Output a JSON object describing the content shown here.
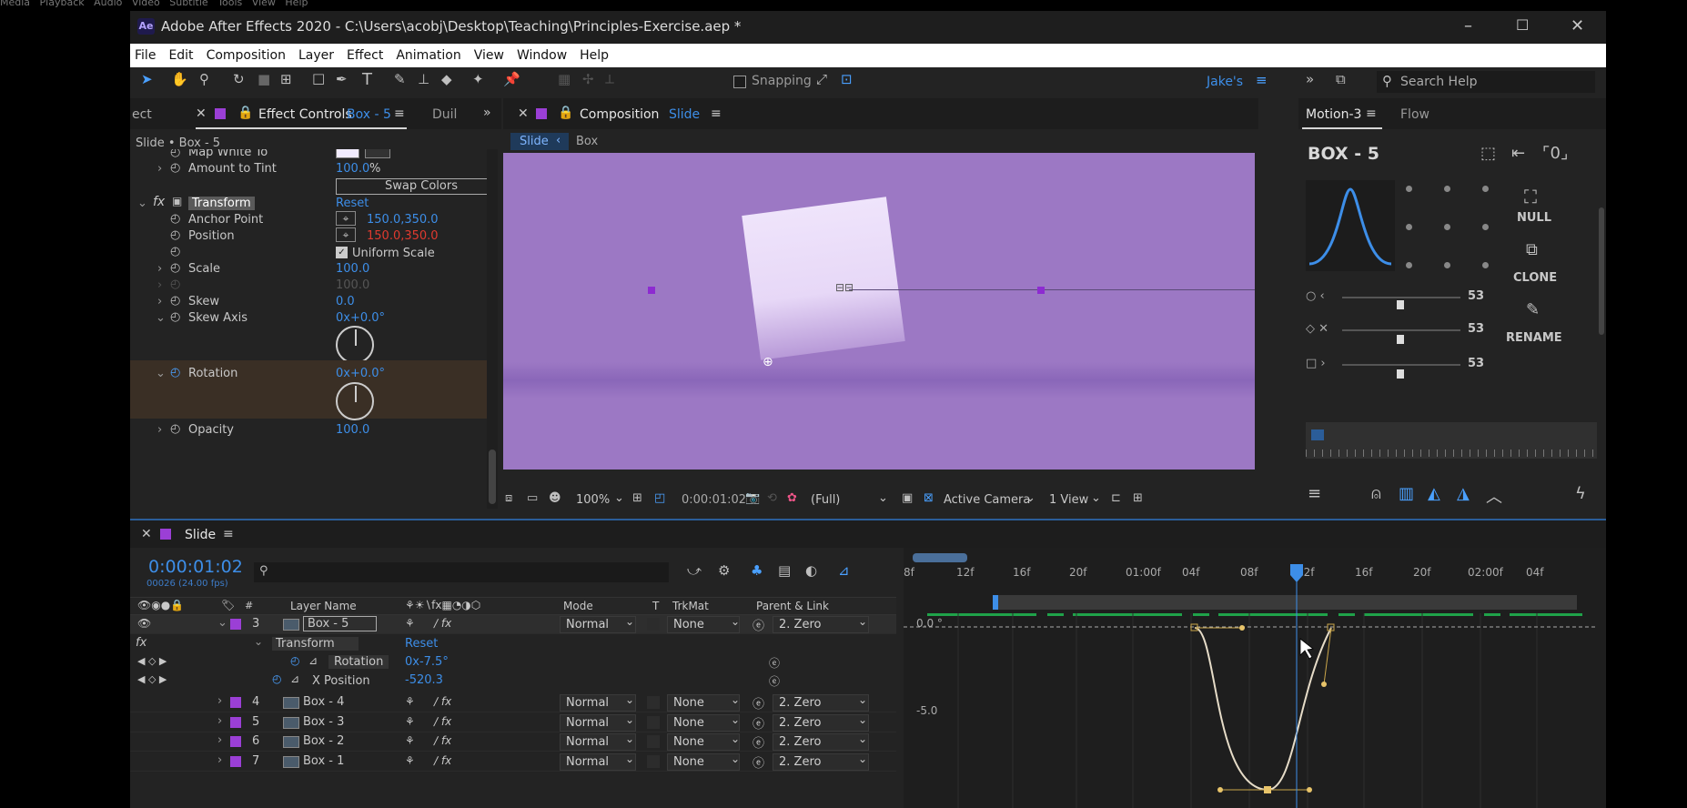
{
  "top_menu_bg": [
    "Media",
    "Playback",
    "Audio",
    "Video",
    "Subtitle",
    "Tools",
    "View",
    "Help"
  ],
  "window": {
    "app_icon": "Ae",
    "title": "Adobe After Effects 2020 - C:\\Users\\acobj\\Desktop\\Teaching\\Principles-Exercise.aep *",
    "controls": {
      "min": "–",
      "max": "☐",
      "close": "✕"
    }
  },
  "menu": [
    "File",
    "Edit",
    "Composition",
    "Layer",
    "Effect",
    "Animation",
    "View",
    "Window",
    "Help"
  ],
  "toolbar": {
    "snapping": "Snapping",
    "workspace": "Jake's",
    "search_placeholder": "Search Help"
  },
  "effect_panel": {
    "tab_prev": "ect",
    "tab_label": "Effect Controls",
    "tab_layer": "Box - 5",
    "tab_next": "Duil",
    "breadcrumb": "Slide • Box - 5",
    "props": {
      "map_white": "Map White To",
      "amount_tint": "Amount to Tint",
      "amount_tint_val": "100.0",
      "amount_tint_unit": "%",
      "swap_colors": "Swap Colors",
      "fx": "fx",
      "transform": "Transform",
      "reset": "Reset",
      "anchor": "Anchor Point",
      "anchor_val": "150.0,350.0",
      "position": "Position",
      "position_val": "150.0,350.0",
      "uniform_scale": "Uniform Scale",
      "scale": "Scale",
      "scale_val": "100.0",
      "scale_h_val": "100.0",
      "skew": "Skew",
      "skew_val": "0.0",
      "skew_axis": "Skew Axis",
      "skew_axis_val": "0x+0.0°",
      "rotation": "Rotation",
      "rotation_val": "0x+0.0°",
      "opacity": "Opacity",
      "opacity_val": "100.0"
    }
  },
  "comp_panel": {
    "tab_label": "Composition",
    "tab_name": "Slide",
    "crumb1": "Slide",
    "crumb2": "Box",
    "zoom": "100%",
    "timecode": "0:00:01:02",
    "resolution": "(Full)",
    "camera": "Active Camera",
    "views": "1 View"
  },
  "motion_panel": {
    "tab": "Motion-3",
    "tab2": "Flow",
    "layer": "BOX - 5",
    "slider_vals": [
      "53",
      "53",
      "53"
    ],
    "null": "NULL",
    "clone": "CLONE",
    "rename": "RENAME"
  },
  "timeline": {
    "comp_name": "Slide",
    "timecode": "0:00:01:02",
    "fps": "00026 (24.00 fps)",
    "col_layer": "Layer Name",
    "col_mode": "Mode",
    "col_t": "T",
    "col_trkmat": "TrkMat",
    "col_parent": "Parent & Link",
    "ruler": [
      "8f",
      "12f",
      "16f",
      "20f",
      "01:00f",
      "04f",
      "08f",
      "12f",
      "16f",
      "20f",
      "02:00f",
      "04f"
    ],
    "graph_labels": [
      "0.0 °",
      "-5.0"
    ],
    "layers": [
      {
        "num": "3",
        "name": "Box - 5",
        "mode": "Normal",
        "trkmat": "None",
        "parent": "2. Zero"
      },
      {
        "num": "4",
        "name": "Box - 4",
        "mode": "Normal",
        "trkmat": "None",
        "parent": "2. Zero"
      },
      {
        "num": "5",
        "name": "Box - 3",
        "mode": "Normal",
        "trkmat": "None",
        "parent": "2. Zero"
      },
      {
        "num": "6",
        "name": "Box - 2",
        "mode": "Normal",
        "trkmat": "None",
        "parent": "2. Zero"
      },
      {
        "num": "7",
        "name": "Box - 1",
        "mode": "Normal",
        "trkmat": "None",
        "parent": "2. Zero"
      }
    ],
    "sub": {
      "fx": "fx",
      "transform": "Transform",
      "reset": "Reset",
      "rotation": "Rotation",
      "rotation_val": "0x-7.5°",
      "xpos": "X Position",
      "xpos_val": "-520.3"
    }
  },
  "colors": {
    "accent": "#3d8ee8",
    "label_purple": "#9b3fd6",
    "comp_bg": "#9c78c4",
    "keyframe_red": "#e03a2f"
  }
}
